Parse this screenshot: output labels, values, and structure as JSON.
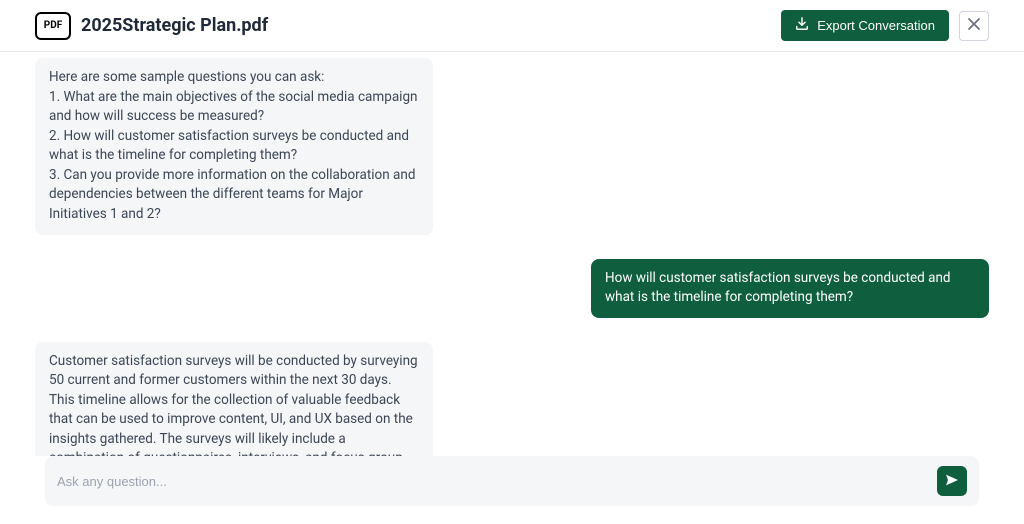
{
  "header": {
    "pdf_badge": "PDF",
    "title": "2025Strategic Plan.pdf",
    "export_label": "Export Conversation"
  },
  "messages": {
    "assistant1": "Here are some sample questions you can ask:\n1. What are the main objectives of the social media campaign and how will success be measured?\n2. How will customer satisfaction surveys be conducted and what is the timeline for completing them?\n3. Can you provide more information on the collaboration and dependencies between the different teams for Major Initiatives 1 and 2?",
    "user1": "How will customer satisfaction surveys be conducted and what is the timeline for completing them?",
    "assistant2": "Customer satisfaction surveys will be conducted by surveying 50 current and former customers within the next 30 days. This timeline allows for the collection of valuable feedback that can be used to improve content, UI, and UX based on the insights gathered. The surveys will likely include a combination of questionnaires, interviews, and focus group discussions (FGDs) to ensure comprehensive data collection."
  },
  "input": {
    "placeholder": "Ask any question..."
  },
  "colors": {
    "brand": "#0f5e3d"
  }
}
